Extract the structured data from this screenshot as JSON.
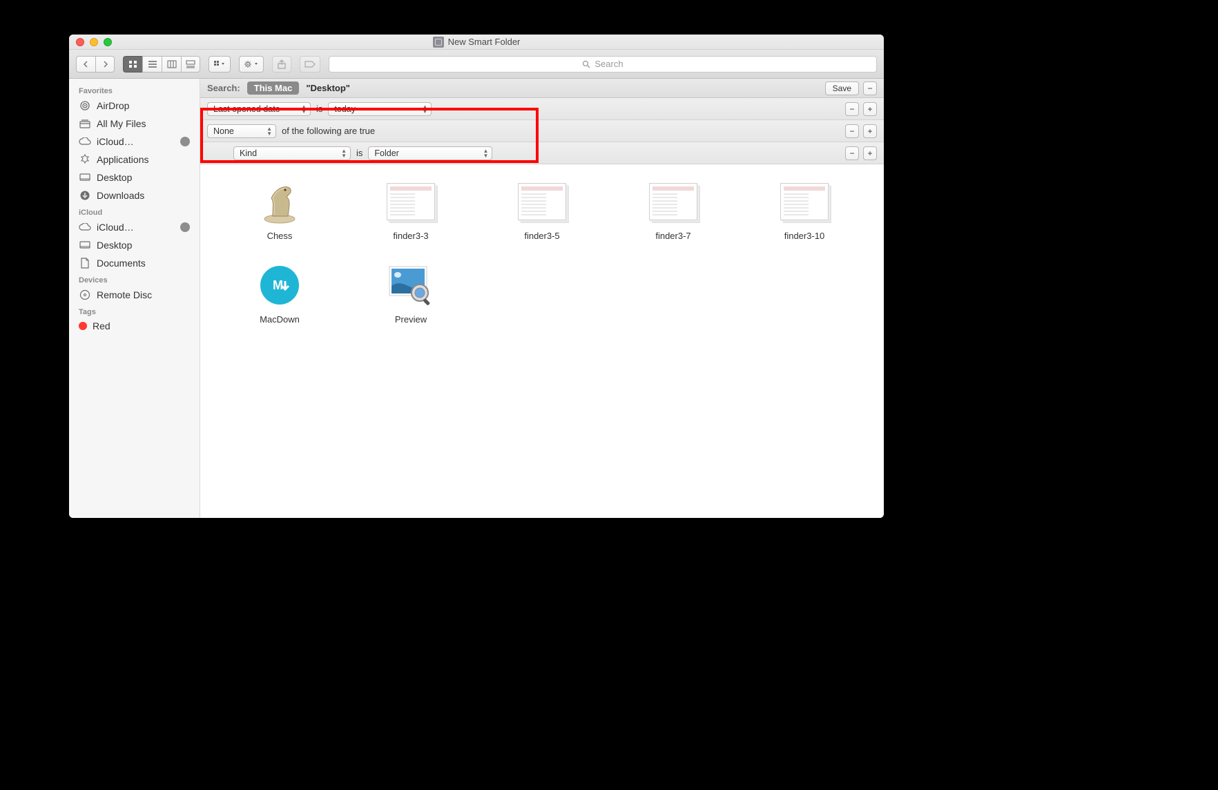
{
  "window": {
    "title": "New Smart Folder"
  },
  "toolbar": {
    "search_placeholder": "Search"
  },
  "scopebar": {
    "label": "Search:",
    "this_mac": "This Mac",
    "location": "\"Desktop\"",
    "save": "Save"
  },
  "criteria": {
    "row1": {
      "attr": "Last opened date",
      "op": "is",
      "val": "today"
    },
    "row2": {
      "mode": "None",
      "text": "of the following are true"
    },
    "row3": {
      "attr": "Kind",
      "op": "is",
      "val": "Folder"
    }
  },
  "sidebar": {
    "sections": {
      "favorites": "Favorites",
      "icloud": "iCloud",
      "devices": "Devices",
      "tags": "Tags"
    },
    "items": {
      "airdrop": "AirDrop",
      "allmyfiles": "All My Files",
      "iclouddrive": "iCloud…",
      "applications": "Applications",
      "desktop": "Desktop",
      "downloads": "Downloads",
      "iclouddrive2": "iCloud…",
      "desktop2": "Desktop",
      "documents": "Documents",
      "remotedisc": "Remote Disc",
      "red": "Red"
    }
  },
  "files": [
    {
      "name": "Chess"
    },
    {
      "name": "finder3-3"
    },
    {
      "name": "finder3-5"
    },
    {
      "name": "finder3-7"
    },
    {
      "name": "finder3-10"
    },
    {
      "name": "MacDown"
    },
    {
      "name": "Preview"
    }
  ]
}
